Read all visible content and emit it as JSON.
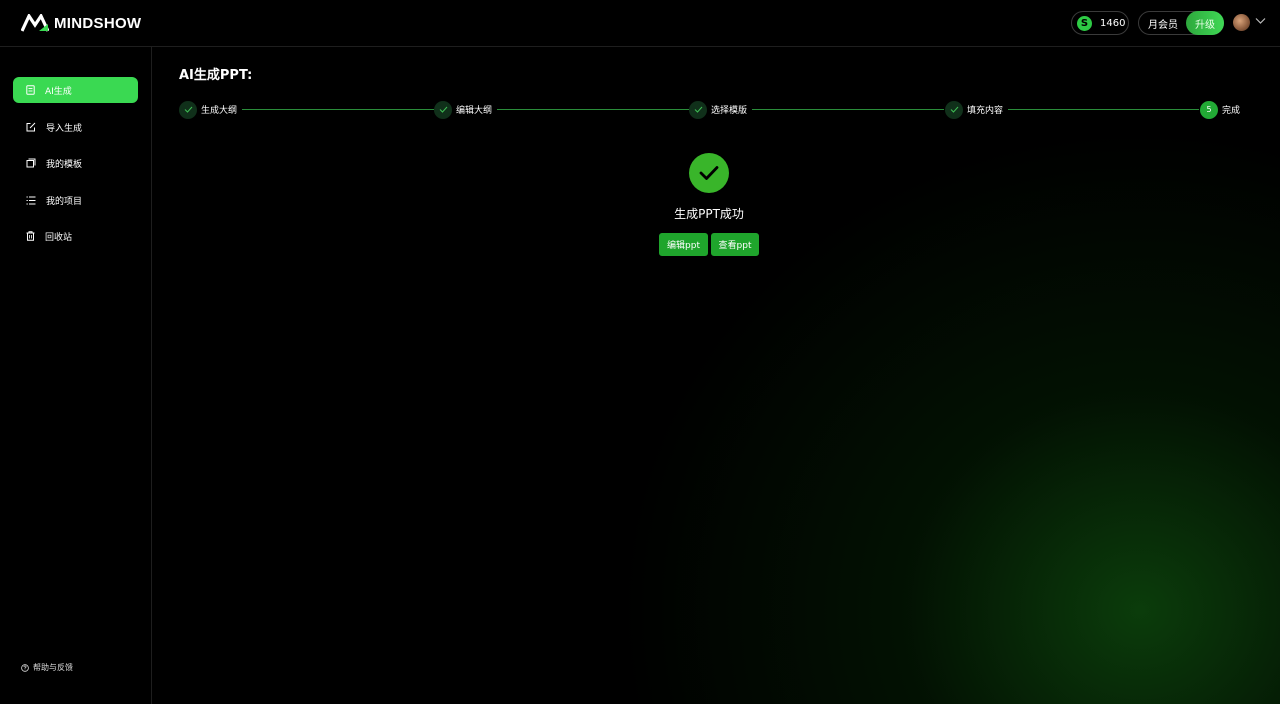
{
  "header": {
    "logo_text": "MINDSHOW",
    "coins": {
      "icon": "S",
      "value": "1460"
    },
    "membership": {
      "label": "月会员",
      "upgrade_label": "升级"
    }
  },
  "sidebar": {
    "items": [
      {
        "label": "AI生成",
        "icon": "document-icon",
        "active": true
      },
      {
        "label": "导入生成",
        "icon": "import-icon",
        "active": false
      },
      {
        "label": "我的模板",
        "icon": "template-icon",
        "active": false
      },
      {
        "label": "我的项目",
        "icon": "list-icon",
        "active": false
      },
      {
        "label": "回收站",
        "icon": "trash-icon",
        "active": false
      }
    ],
    "help_label": "帮助与反馈"
  },
  "main": {
    "title": "AI生成PPT:",
    "steps": [
      {
        "label": "生成大纲",
        "status": "done"
      },
      {
        "label": "编辑大纲",
        "status": "done"
      },
      {
        "label": "选择模版",
        "status": "done"
      },
      {
        "label": "填充内容",
        "status": "done"
      },
      {
        "label": "完成",
        "status": "current",
        "number": "5"
      }
    ],
    "success_text": "生成PPT成功",
    "buttons": {
      "edit": "编辑ppt",
      "view": "查看ppt"
    }
  },
  "colors": {
    "accent": "#3ad952",
    "button": "#1fa52c",
    "background": "#000000"
  }
}
